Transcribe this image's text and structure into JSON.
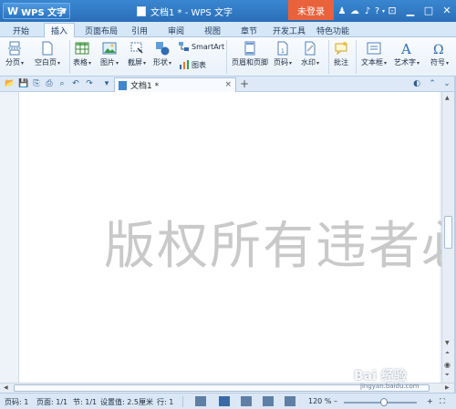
{
  "titlebar": {
    "app_name": "WPS 文字",
    "app_logo": "W",
    "doc_title": "文档1 * - WPS 文字",
    "login_label": "未登录",
    "icons": [
      "shirt-icon",
      "skin-icon",
      "bell-icon",
      "help-icon"
    ],
    "help_glyph": "?",
    "window_controls": [
      "restore-box-icon",
      "minimize-icon",
      "maximize-icon",
      "close-icon"
    ]
  },
  "tabs": [
    {
      "label": "开始"
    },
    {
      "label": "插入",
      "active": true
    },
    {
      "label": "页面布局"
    },
    {
      "label": "引用"
    },
    {
      "label": "审阅"
    },
    {
      "label": "视图"
    },
    {
      "label": "章节"
    },
    {
      "label": "开发工具"
    },
    {
      "label": "特色功能"
    }
  ],
  "ribbon": {
    "page_break": "分页",
    "blank_page": "空白页",
    "table": "表格",
    "picture": "图片",
    "screenshot": "截屏",
    "shape": "形状",
    "smartart": "SmartArt",
    "chart": "图表",
    "header_footer": "页眉和页脚",
    "page_number": "页码",
    "watermark": "水印",
    "comment": "批注",
    "textbox": "文本框",
    "art_text": "艺术字",
    "symbol": "符号"
  },
  "doc_tab": {
    "label": "文档1 *",
    "close": "×",
    "add": "+"
  },
  "document": {
    "watermark_text": "版权所有违者必"
  },
  "statusbar": {
    "page_no": "页码: 1",
    "pages": "页面: 1/1",
    "section": "节: 1/1",
    "setting": "设置值: 2.5厘米",
    "row": "行: 1",
    "zoom": "120 %",
    "zoom_minus": "–",
    "zoom_plus": "+",
    "zoom_level": 0.55
  },
  "overlay": {
    "baidu_logo": "Bai 经验",
    "baidu_url": "jingyan.baidu.com"
  },
  "colors": {
    "titlebar": "#2a6fb8",
    "login": "#e8623b",
    "watermark": "#c9c9c9"
  }
}
